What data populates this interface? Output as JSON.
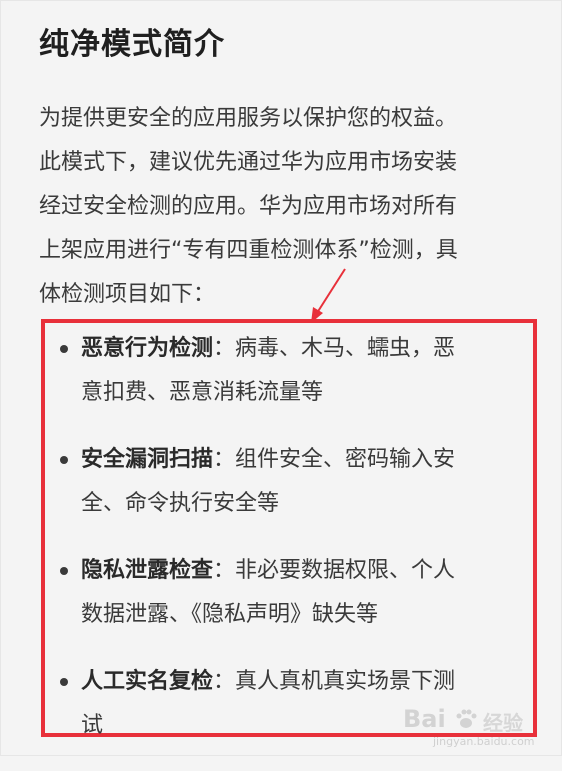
{
  "title": "纯净模式简介",
  "intro_lines": [
    "为提供更安全的应用服务以保护您的权益。",
    "此模式下，建议优先通过华为应用市场安装",
    "经过安全检测的应用。华为应用市场对所有",
    "上架应用进行“专有四重检测体系”检测，具",
    "体检测项目如下："
  ],
  "items": [
    {
      "title": "恶意行为检测",
      "line1_rest": "：病毒、木马、蠕虫，恶",
      "line2": "意扣费、恶意消耗流量等"
    },
    {
      "title": "安全漏洞扫描",
      "line1_rest": "：组件安全、密码输入安",
      "line2": "全、命令执行安全等"
    },
    {
      "title": "隐私泄露检查",
      "line1_rest": "：非必要数据权限、个人",
      "line2": "数据泄露、《隐私声明》缺失等"
    },
    {
      "title": "人工实名复检",
      "line1_rest": "：真人真机真实场景下测",
      "line2": "试"
    }
  ],
  "annotation": {
    "color": "#e8303a",
    "icon": "arrow-icon"
  },
  "watermark": {
    "logo": "Bai",
    "logo_icon": "paw-icon",
    "cn": "经验",
    "url": "jingyan.baidu.com"
  }
}
